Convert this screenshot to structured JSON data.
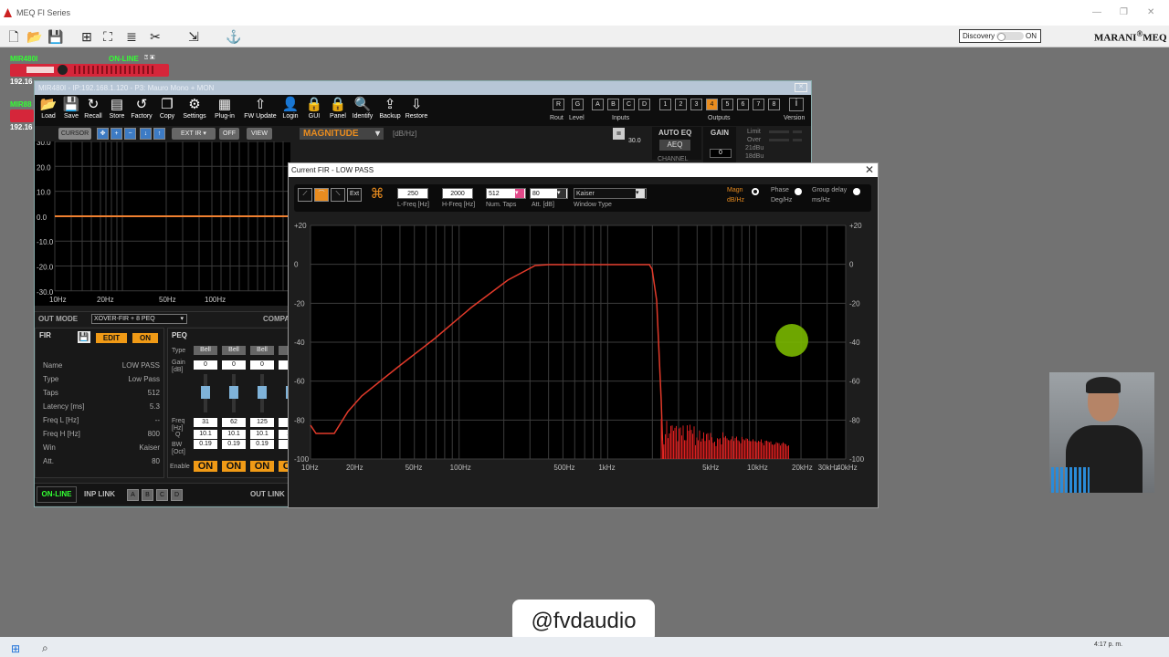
{
  "app": {
    "title": "MEQ FI Series",
    "brand": "MARANI",
    "brand_suffix": "MEQ",
    "discovery_label": "Discovery",
    "discovery_state": "ON"
  },
  "devices": [
    {
      "name": "MIR480I",
      "status": "ON-LINE",
      "ip": "192.16"
    },
    {
      "name": "MIR88",
      "ip": "192.16"
    }
  ],
  "main": {
    "title": "MIR480I - IP:192.168.1.120 - P3: Mauro Mono + MON",
    "tools": [
      "Load",
      "Save",
      "Recall",
      "Store",
      "Factory",
      "Copy",
      "Settings",
      "Plug-in",
      "FW Update",
      "Login",
      "GUI",
      "Panel",
      "Identify",
      "Backup",
      "Restore"
    ],
    "rout_label": "Rout",
    "level_label": "Level",
    "inputs_label": "Inputs",
    "outputs_label": "Outputs",
    "version_label": "Version",
    "rout": "R",
    "level": "G",
    "inputs": [
      "A",
      "B",
      "C",
      "D"
    ],
    "outputs": [
      "1",
      "2",
      "3",
      "4",
      "5",
      "6",
      "7",
      "8"
    ],
    "selected_output": "4",
    "graph_controls": {
      "cursor": "CURSOR",
      "ext_ir": "EXT IR",
      "off": "OFF",
      "view": "VIEW",
      "mode": "MAGNITUDE",
      "unit": "[dB/Hz]",
      "right_val": "30.0"
    },
    "left_y_ticks": [
      "30.0",
      "20.0",
      "10.0",
      "0.0",
      "-10.0",
      "-20.0",
      "-30.0"
    ],
    "left_x_ticks": [
      "10Hz",
      "20Hz",
      "50Hz",
      "100Hz"
    ],
    "auto_eq": {
      "title": "AUTO EQ",
      "button": "AEQ",
      "channel": "CHANNEL"
    },
    "gain": {
      "title": "GAIN",
      "value": "0"
    },
    "meter_labels": [
      "Limit",
      "Over",
      "21dBu",
      "18dBu"
    ],
    "out_mode_label": "OUT MODE",
    "out_mode_value": "XOVER-FIR + 8 PEQ",
    "compa_label": "COMPA",
    "fir": {
      "label": "FIR",
      "edit": "EDIT",
      "on": "ON",
      "props": [
        {
          "k": "Name",
          "v": "LOW PASS"
        },
        {
          "k": "Type",
          "v": "Low Pass"
        },
        {
          "k": "Taps",
          "v": "512"
        },
        {
          "k": "Latency [ms]",
          "v": "5.3"
        },
        {
          "k": "Freq L [Hz]",
          "v": "--"
        },
        {
          "k": "Freq H [Hz]",
          "v": "800"
        },
        {
          "k": "Win",
          "v": "Kaiser"
        },
        {
          "k": "Att.",
          "v": "80"
        }
      ]
    },
    "peq": {
      "label": "PEQ",
      "type_label": "Type",
      "gain_label": "Gain [dB]",
      "freq_label": "Freq [Hz]",
      "q_label": "Q",
      "bw_label": "BW [Oct]",
      "enable_label": "Enable",
      "bands": [
        {
          "type": "Bell",
          "gain": "0",
          "freq": "31",
          "q": "10.1",
          "bw": "0.19",
          "enable": "ON"
        },
        {
          "type": "Bell",
          "gain": "0",
          "freq": "62",
          "q": "10.1",
          "bw": "0.19",
          "enable": "ON"
        },
        {
          "type": "Bell",
          "gain": "0",
          "freq": "125",
          "q": "10.1",
          "bw": "0.19",
          "enable": "ON"
        },
        {
          "type": "B",
          "gain": "0",
          "freq": "2",
          "q": "10",
          "bw": "0.",
          "enable": "ON"
        }
      ]
    },
    "footer": {
      "online": "ON-LINE",
      "inp_link": "INP LINK",
      "inp_link_buttons": [
        "A",
        "B",
        "C",
        "D"
      ],
      "out_link": "OUT LINK"
    }
  },
  "dialog": {
    "title": "Current FIR - LOW PASS",
    "lfreq": "250",
    "lfreq_label": "L-Freq [Hz]",
    "hfreq": "2000",
    "hfreq_label": "H-Freq [Hz]",
    "taps": "512",
    "taps_label": "Num. Taps",
    "att": "80",
    "att_label": "Att. [dB]",
    "window": "Kaiser",
    "window_label": "Window Type",
    "ext_label": "Ext",
    "modes": [
      {
        "name": "Magn",
        "unit": "dB/Hz",
        "active": true
      },
      {
        "name": "Phase",
        "unit": "Deg/Hz",
        "active": false
      },
      {
        "name": "Group delay",
        "unit": "ms/Hz",
        "active": false
      }
    ],
    "y_ticks": [
      "+20",
      "0",
      "-20",
      "-40",
      "-60",
      "-80",
      "-100"
    ],
    "x_ticks": [
      "10Hz",
      "20Hz",
      "50Hz",
      "100Hz",
      "500Hz",
      "1kHz",
      "5kHz",
      "10kHz",
      "20kHz",
      "30kHz",
      "40kHz"
    ]
  },
  "overlay": {
    "handle": "@fvdaudio"
  },
  "taskbar": {
    "time": "4:17 p. m."
  },
  "colors": {
    "accent": "#f09a16",
    "curve": "#e23a2a",
    "cursor_dot": "#7ab800",
    "online": "#33ff33"
  }
}
